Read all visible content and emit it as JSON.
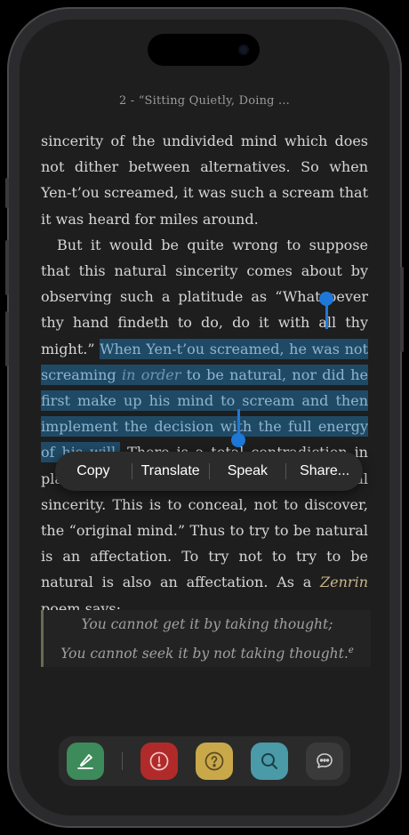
{
  "header": {
    "chapter_title": "2 - “Sitting Quietly, Doing ..."
  },
  "book": {
    "para1": "sincerity of the undivided mind which does not dither between alternatives. So when Yen-t’ou screamed, it was such a scream that it was heard for miles around.",
    "para2_pre": "But it would be quite wrong to suppose that this natural sincerity comes about by observing such a platitude as “Whatsoever thy hand findeth to do, do it with all thy might.” ",
    "para2_sel_a": "When Yen-t’ou screamed, he was not screaming ",
    "para2_sel_italic": "in order",
    "para2_sel_b": " to be natural, nor did he first make up his mind to scream and then implement the decision with the full energy of his will.",
    "para2_post_a": " There is a total contradiction in planned naturalness and intentional sincerity. This is to conceal, not to discover, the “original mind.” Thus to try to be natural is an affectation. To try not to try to be natural is also an affectation. As a ",
    "zenrin": "Zenrin",
    "para2_post_b": " poem says:",
    "quote_line1": "You cannot get it by taking thought;",
    "quote_line2": "You cannot seek it by not taking thought.",
    "footnote_mark": "e"
  },
  "context_menu": {
    "copy": "Copy",
    "translate": "Translate",
    "speak": "Speak",
    "share": "Share..."
  },
  "toolbar": {
    "highlight": {
      "icon": "highlighter-icon",
      "color": "#3d8a5a"
    },
    "alert": {
      "icon": "exclamation-circle-icon",
      "color": "#b12a2a"
    },
    "question": {
      "icon": "question-circle-icon",
      "color": "#c9a84a"
    },
    "search": {
      "icon": "search-icon",
      "color": "#4a9aa8"
    },
    "comment": {
      "icon": "chat-bubble-icon",
      "color": "#3a3a3a"
    }
  }
}
